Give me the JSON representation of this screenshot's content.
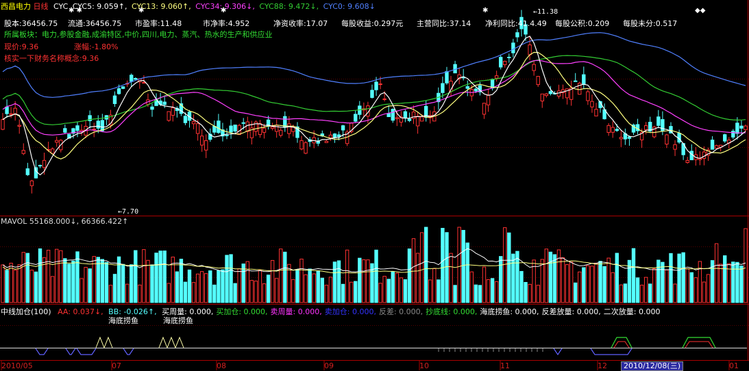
{
  "header": {
    "stock_name": "西昌电力",
    "period": "日线",
    "cyc_label": "CYC",
    "cyc5": "CYC5: 9.059↑,",
    "cyc13": "CYC13: 9.060↑,",
    "cyc34": "CYC34: 9.306↓,",
    "cyc88": "CYC88: 9.472↓,",
    "cyc0": "CYC0: 9.608↓"
  },
  "info": {
    "row1": [
      "股本:36456.75",
      "流通:36456.75",
      "市盈率:11.48",
      "市净率:4.952",
      "净资收率:17.07",
      "每股收益:0.297元",
      "主营同比:37.14",
      "净利同比:41.4.49",
      "每股公积:0.209",
      "每股未分:0.517"
    ],
    "sector": "所属板块：电力,参股金融,成渝特区,中价,四川,电力、蒸汽、热水的生产和供应业",
    "price": "现价:9.36",
    "change": "涨幅:-1.80%",
    "nav_line": "核实一下财务名称概念:9.36"
  },
  "annotations": {
    "high": "←11.38",
    "low": "←7.70"
  },
  "volume_panel": {
    "title": "MAVOL 55168.000↓, 66366.422↑"
  },
  "indicator_panel": {
    "title": "中线加仓(100)",
    "aa": "AA: 0.037↓,",
    "bb": "BB: -0.026↑,",
    "rest": [
      {
        "text": "买周量: 0.000,",
        "color": "#ffffff"
      },
      {
        "text": "买加仓: 0.000,",
        "color": "#33dd33"
      },
      {
        "text": "卖周量: 0.000,",
        "color": "#ff33ff"
      },
      {
        "text": "卖加仓: 0.000,",
        "color": "#3333ff"
      },
      {
        "text": "反差: 0.000,",
        "color": "#888888"
      },
      {
        "text": "抄底线: 0.000,",
        "color": "#33dd33"
      },
      {
        "text": "海底捞鱼: 0.000,",
        "color": "#ffffff"
      },
      {
        "text": "反差放量: 0.000,",
        "color": "#ffffff"
      },
      {
        "text": "二次放量: 0.000",
        "color": "#ffffff"
      }
    ],
    "signal1": "海底捞鱼",
    "signal2": "海底捞鱼"
  },
  "date_axis": {
    "labels": [
      "2010/05",
      "07",
      "08",
      "09",
      "10",
      "11",
      "12",
      "01"
    ],
    "cursor_date": "2010/12/08(三)"
  },
  "colors": {
    "up": "#ff3232",
    "down": "#54ffff",
    "ma5": "#ffffff",
    "ma13": "#ffff80",
    "ma34": "#ff40ff",
    "ma88": "#33cc33",
    "ma0": "#5080ff"
  }
}
